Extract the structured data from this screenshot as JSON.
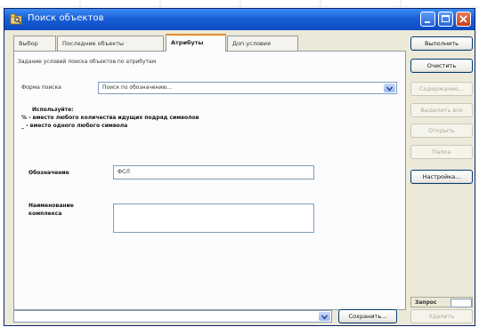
{
  "window": {
    "title": "Поиск объектов"
  },
  "tabs": [
    {
      "label": "Выбор"
    },
    {
      "label": "Последние объекты"
    },
    {
      "label": "Атрибуты",
      "active": true
    },
    {
      "label": "Доп.условия"
    }
  ],
  "panel": {
    "heading": "Задание условий поиска объектов по атрибутам",
    "search_form": {
      "label": "Форма поиска",
      "value": "Поиск по обозначению..."
    },
    "hint": {
      "title": "Используйте:",
      "line1": "% - вместо любого количества идущих подряд символов",
      "line2": "_ - вместо одного любого символа"
    },
    "designation": {
      "label": "Обозначение",
      "value": "ФСЛ"
    },
    "complex_name": {
      "label_line1": "Наименование",
      "label_line2": "комплекса",
      "value": ""
    }
  },
  "buttons": {
    "execute": "Выполнить",
    "clear": "Очистить",
    "content": "Содержание...",
    "select_all": "Выделить все",
    "open": "Открыть",
    "folder": "Папка",
    "settings": "Настройка...",
    "save": "Сохранить...",
    "delete": "Удалить"
  },
  "bottom": {
    "combo_value": ""
  },
  "status": {
    "label": "Запрос"
  }
}
